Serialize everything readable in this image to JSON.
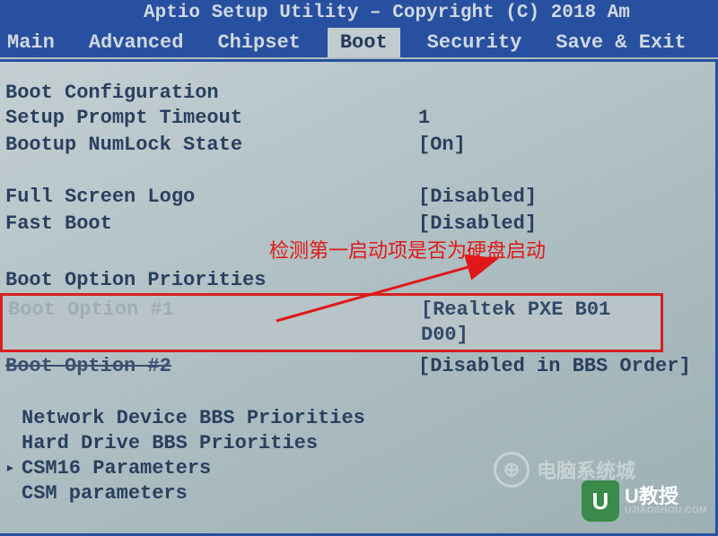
{
  "title": "Aptio Setup Utility – Copyright (C) 2018 Am",
  "tabs": {
    "main": "Main",
    "advanced": "Advanced",
    "chipset": "Chipset",
    "boot": "Boot",
    "security": "Security",
    "saveexit": "Save & Exit"
  },
  "active_tab": "boot",
  "sections": {
    "boot_config_title": "Boot Configuration",
    "setup_prompt_label": "Setup Prompt Timeout",
    "setup_prompt_value": "1",
    "numlock_label": "Bootup NumLock State",
    "numlock_value": "[On]",
    "fullscreen_label": "Full Screen Logo",
    "fullscreen_value": "[Disabled]",
    "fastboot_label": "Fast Boot",
    "fastboot_value": "[Disabled]",
    "priorities_title": "Boot Option Priorities",
    "boot1_label": "Boot Option #1",
    "boot1_value": "[Realtek PXE B01 D00]",
    "boot2_label": "Boot Option #2",
    "boot2_value": "[Disabled in BBS Order]",
    "network_bbs": "Network Device BBS Priorities",
    "hdd_bbs": "Hard Drive BBS Priorities",
    "csm16": "CSM16 Parameters",
    "csm": "CSM parameters"
  },
  "annotation": "检测第一启动项是否为硬盘启动",
  "colors": {
    "frame": "#2850a0",
    "text": "#2a4060",
    "highlight_border": "#d62020",
    "annotation": "#e01818"
  },
  "watermarks": {
    "wm1_text": "电脑系统城",
    "wm2_brand": "U教授",
    "wm2_sub": "UJIAOSHOU.COM",
    "wm2_icon": "U"
  }
}
